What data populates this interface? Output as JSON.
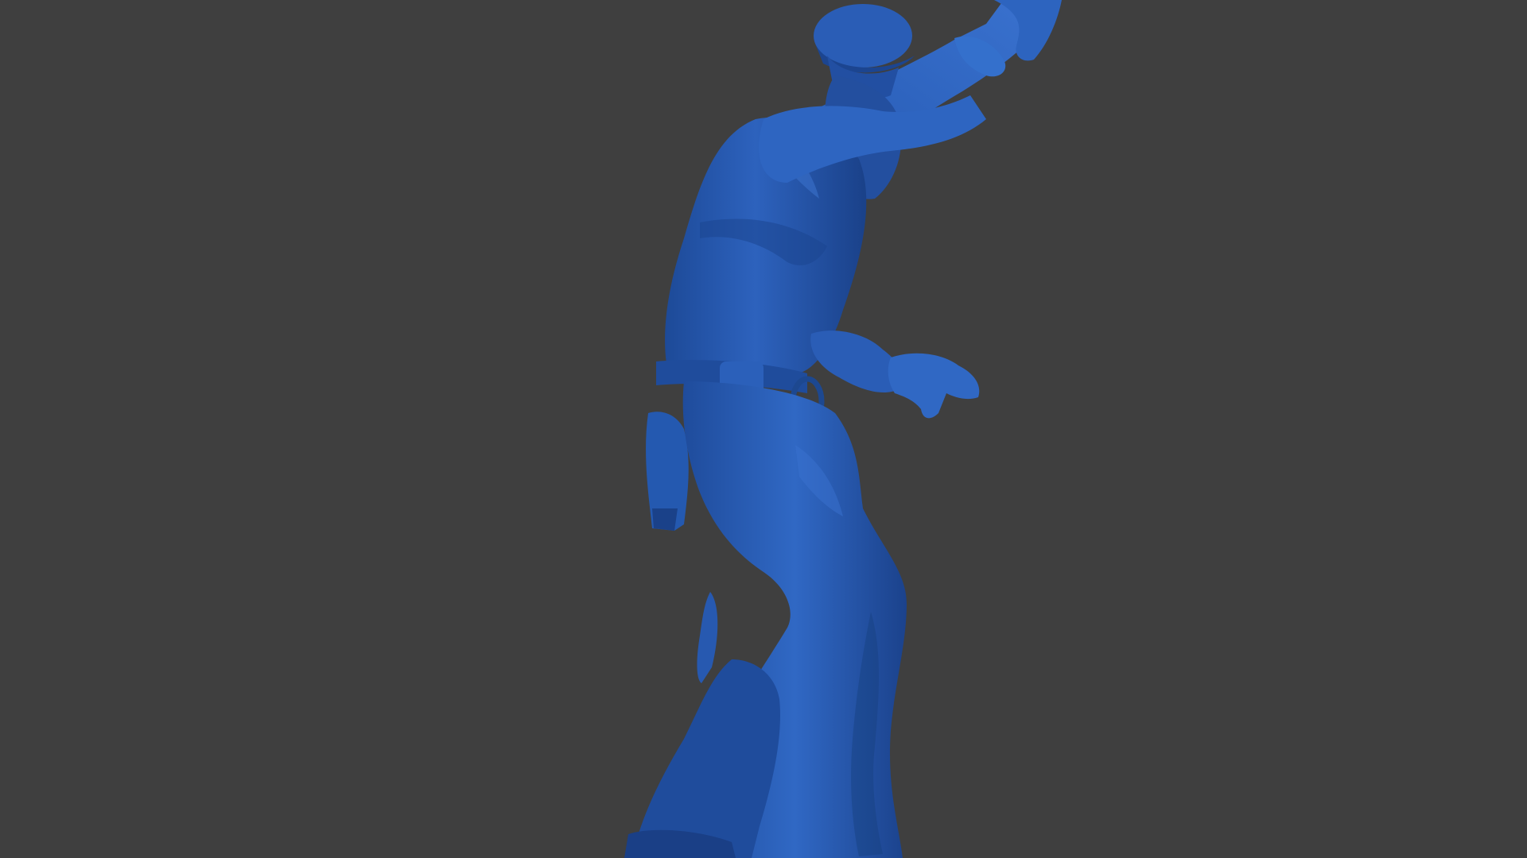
{
  "viewport": {
    "background_color": "#3f3f3f",
    "model_color": "#2a5cb4",
    "model_highlight": "#3d74d2",
    "model_shadow": "#173d82",
    "subject": "3d-sculpt-figure"
  }
}
